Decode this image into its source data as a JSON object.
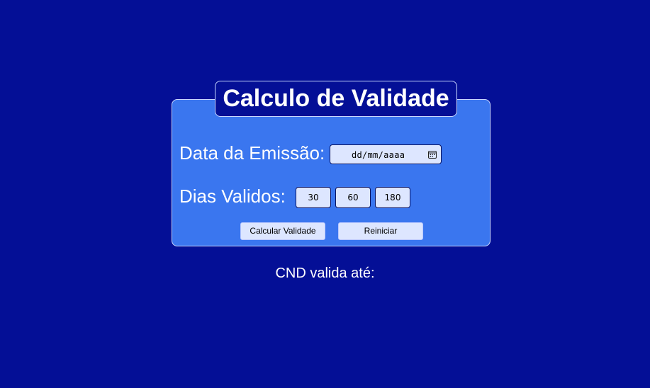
{
  "form": {
    "title": "Calculo de Validade",
    "date_label": "Data da Emissão:",
    "date_placeholder": "dd/mm/aaaa",
    "days_label": "Dias Validos:",
    "day_options": [
      "30",
      "60",
      "180"
    ],
    "calc_button": "Calcular Validade",
    "reset_button": "Reiniciar"
  },
  "result": {
    "label": "CND valida até:"
  },
  "colors": {
    "background": "#040f96",
    "card": "#3a76ef",
    "input_bg": "#dde6ff"
  },
  "icons": {
    "date_picker": "calendar-icon"
  }
}
